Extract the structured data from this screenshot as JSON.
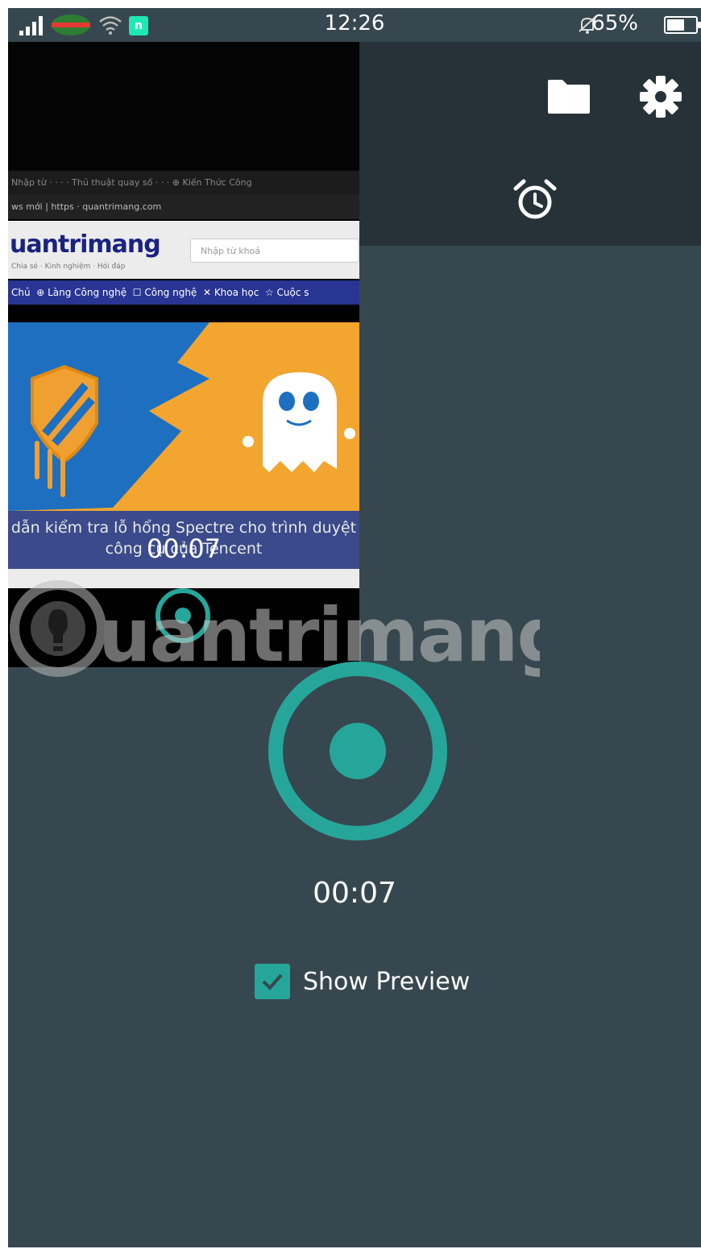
{
  "status_bar": {
    "time": "12:26",
    "battery": "65%",
    "battery_level": 0.65,
    "icons": [
      "signal-icon",
      "carrier-icon",
      "wifi-icon",
      "app-notification-icon",
      "bell-muted-icon",
      "battery-icon"
    ]
  },
  "toolbar": {
    "folder_icon": "folder-icon",
    "settings_icon": "gear-icon",
    "timer_icon": "alarm-clock-icon"
  },
  "preview": {
    "site_logo": "uantrimang",
    "search_placeholder": "Nhập từ khoá",
    "nav_items": [
      "Chủ",
      "Làng Công nghệ",
      "Công nghệ",
      "Khoa học",
      "Cuộc s"
    ],
    "caption_line1": "dẫn kiểm tra lỗ hổng Spectre cho trình duyệt",
    "caption_line2": "công cụ của Tencent",
    "elapsed": "00:07"
  },
  "watermark": {
    "text": "uantrimang"
  },
  "recorder": {
    "elapsed": "00:07",
    "show_preview_label": "Show Preview",
    "show_preview_checked": true
  },
  "colors": {
    "background": "#37474f",
    "toolbar": "#263238",
    "accent": "#26a69a"
  }
}
